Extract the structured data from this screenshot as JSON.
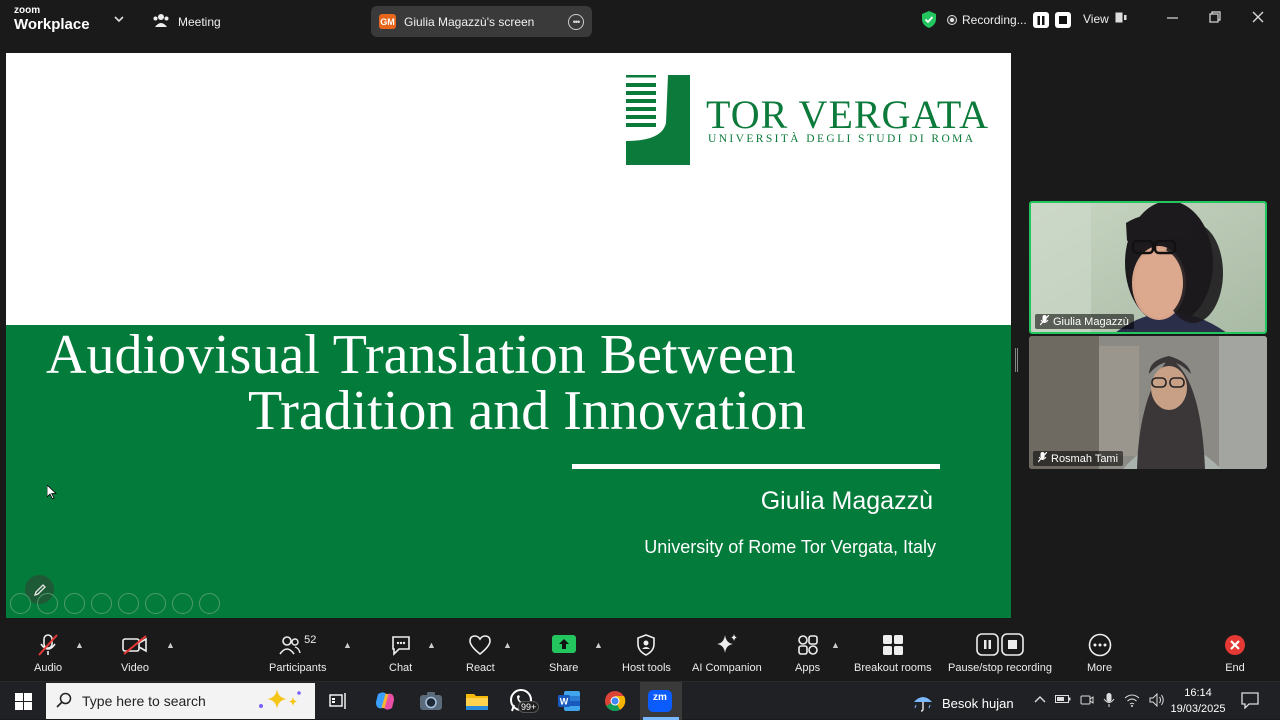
{
  "titlebar": {
    "brand_top": "zoom",
    "brand_bottom": "Workplace",
    "meeting_label": "Meeting",
    "screen_badge": "GM",
    "screen_label": "Giulia Magazzù's screen",
    "recording_label": "Recording...",
    "view_label": "View"
  },
  "slide": {
    "logo_title": "TOR VERGATA",
    "logo_subtitle": "UNIVERSITÀ DEGLI STUDI DI ROMA",
    "title_line1": "Audiovisual Translation Between",
    "title_line2": "Tradition and Innovation",
    "author": "Giulia Magazzù",
    "affiliation": "University of Rome Tor Vergata, Italy",
    "colors": {
      "green": "#037b3b",
      "logo_green": "#0b7a3a"
    }
  },
  "participants_panel": [
    {
      "name": "Giulia Magazzù",
      "active": true
    },
    {
      "name": "Rosmah Tami",
      "active": false
    }
  ],
  "toolbar": {
    "audio": "Audio",
    "video": "Video",
    "participants": "Participants",
    "participants_count": "52",
    "chat": "Chat",
    "react": "React",
    "share": "Share",
    "host_tools": "Host tools",
    "ai_companion": "AI Companion",
    "apps": "Apps",
    "breakout_rooms": "Breakout rooms",
    "pause_stop_recording": "Pause/stop recording",
    "more": "More",
    "end": "End"
  },
  "taskbar": {
    "search_placeholder": "Type here to search",
    "whatsapp_badge": "99+",
    "zoom_label": "zm",
    "weather": "Besok hujan",
    "time": "16:14",
    "date": "19/03/2025"
  }
}
